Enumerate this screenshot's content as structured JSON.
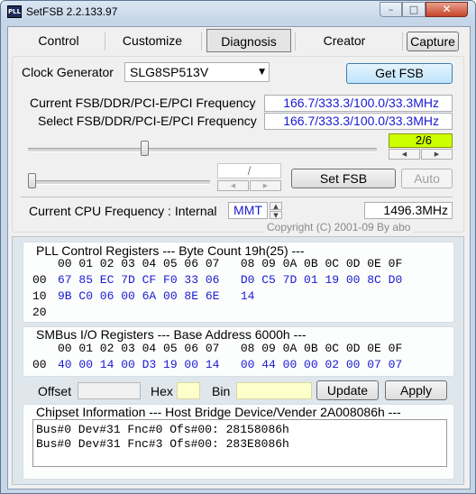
{
  "window": {
    "title": "SetFSB 2.2.133.97",
    "app_icon_text": "PLL",
    "minimize_glyph": "–",
    "maximize_glyph": "□",
    "close_glyph": "✕"
  },
  "tabs": [
    {
      "label": "Control",
      "selected": false
    },
    {
      "label": "Customize",
      "selected": false
    },
    {
      "label": "Diagnosis",
      "selected": true
    },
    {
      "label": "Creator",
      "selected": false
    }
  ],
  "capture_label": "Capture",
  "clock_generator": {
    "label": "Clock Generator",
    "value": "SLG8SP513V",
    "get_fsb_label": "Get FSB"
  },
  "current_freq": {
    "label": "Current FSB/DDR/PCI-E/PCI Frequency",
    "value": "166.7/333.3/100.0/33.3MHz"
  },
  "select_freq": {
    "label": "Select FSB/DDR/PCI-E/PCI Frequency",
    "value": "166.7/333.3/100.0/33.3MHz"
  },
  "slider1": {
    "value_text": "2/6",
    "level": 0.33
  },
  "slider2": {
    "value_text": "/",
    "level": 0.0
  },
  "set_fsb_label": "Set FSB",
  "auto_label": "Auto",
  "cpu": {
    "label": "Current CPU Frequency : Internal",
    "mode": "MMT",
    "value": "1496.3MHz"
  },
  "copyright": "Copyright (C) 2001-09 By abo",
  "pll": {
    "title": "PLL Control Registers  --- Byte Count 19h(25) ---",
    "header": "00 01 02 03 04 05 06 07   08 09 0A 0B 0C 0D 0E 0F",
    "rows": [
      {
        "addr": "00",
        "bytes": "67 85 EC 7D CF F0 33 06   D0 C5 7D 01 19 00 8C D0"
      },
      {
        "addr": "10",
        "bytes": "9B C0 06 00 6A 00 8E 6E   14"
      },
      {
        "addr": "20",
        "bytes": ""
      }
    ]
  },
  "smbus": {
    "title": "SMBus I/O Registers  --- Base Address 6000h ---",
    "header": "00 01 02 03 04 05 06 07   08 09 0A 0B 0C 0D 0E 0F",
    "rows": [
      {
        "addr": "00",
        "bytes": "40 00 14 00 D3 19 00 14   00 44 00 00 02 00 07 07"
      }
    ]
  },
  "editor": {
    "offset_label": "Offset",
    "hex_label": "Hex",
    "bin_label": "Bin",
    "offset_value": "",
    "hex_value": "",
    "bin_value": "",
    "update_label": "Update",
    "apply_label": "Apply"
  },
  "chipset": {
    "title": "Chipset Information  --- Host Bridge Device/Vender 2A008086h ---",
    "lines": [
      "Bus#0 Dev#31 Fnc#0 Ofs#00: 28158086h",
      "Bus#0 Dev#31 Fnc#3 Ofs#00: 283E8086h"
    ]
  },
  "colors": {
    "value_blue": "#1a1ad0",
    "slider_indicator": "#ccff00",
    "hex_highlight": "#ffffcc"
  }
}
